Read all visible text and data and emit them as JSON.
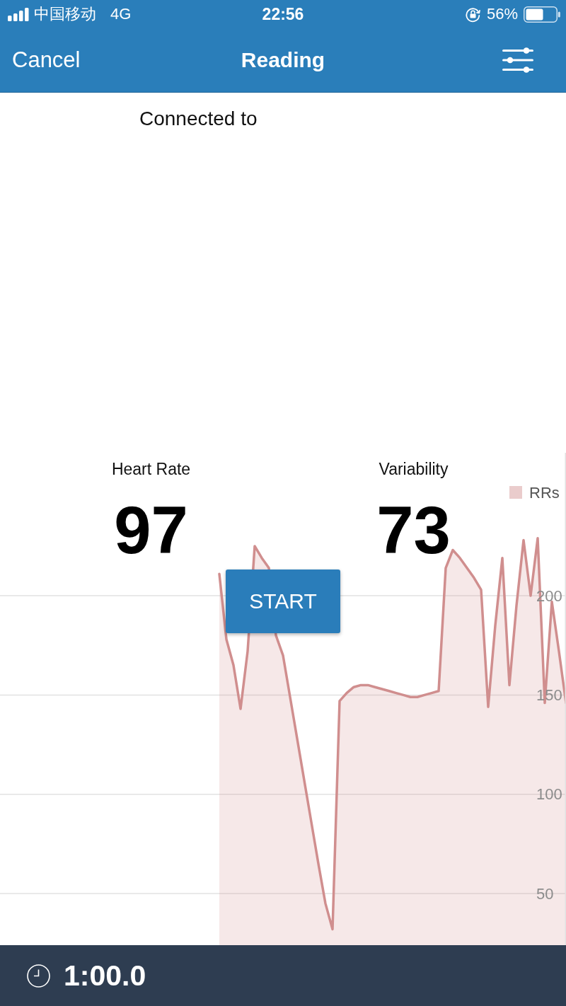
{
  "status_bar": {
    "carrier": "中国移动",
    "network": "4G",
    "time": "22:56",
    "battery": "56%"
  },
  "nav_bar": {
    "cancel": "Cancel",
    "title": "Reading"
  },
  "connection": {
    "label": "Connected to"
  },
  "stats": [
    {
      "label": "Heart Rate",
      "value": "97"
    },
    {
      "label": "Variability",
      "value": "73"
    }
  ],
  "start_button": {
    "label": "START"
  },
  "chart": {
    "chart_data": {
      "type": "area",
      "categories": [
        null,
        null,
        null,
        null,
        null,
        null,
        null,
        null,
        null,
        null,
        null,
        null,
        null,
        null,
        null,
        null,
        null,
        null,
        null,
        null,
        null,
        null,
        null,
        null,
        null,
        null,
        null,
        null,
        null,
        null,
        null,
        null,
        null,
        null,
        null,
        null,
        null,
        null,
        null,
        null,
        null,
        null,
        null,
        null,
        null,
        null,
        null,
        null,
        null,
        null,
        null,
        null,
        null,
        null,
        null,
        null,
        null,
        null,
        null,
        null,
        null,
        null,
        null,
        null,
        null,
        null,
        null,
        null,
        null,
        null,
        null,
        null,
        null,
        null,
        null,
        null,
        null,
        null,
        null,
        null,
        null
      ],
      "series": [
        {
          "name": "RRs",
          "color": "#d08e8e",
          "values": [
            null,
            null,
            null,
            null,
            null,
            null,
            null,
            null,
            null,
            null,
            null,
            null,
            null,
            null,
            null,
            null,
            null,
            null,
            null,
            null,
            null,
            null,
            null,
            null,
            null,
            null,
            null,
            null,
            null,
            null,
            null,
            211,
            178,
            165,
            143,
            172,
            225,
            219,
            214,
            180,
            170,
            149,
            128,
            107,
            86,
            65,
            45,
            32,
            147,
            151,
            154,
            155,
            155,
            154,
            153,
            152,
            151,
            150,
            149,
            149,
            150,
            151,
            152,
            214,
            223,
            219,
            214,
            209,
            203,
            144,
            185,
            219,
            155,
            195,
            228,
            200,
            229,
            146,
            197,
            172,
            146
          ]
        }
      ],
      "ylim": [
        24,
        272
      ],
      "yticks": [
        50,
        100,
        150,
        200
      ],
      "grid": true
    }
  },
  "timer": {
    "value": "1:00.0"
  }
}
